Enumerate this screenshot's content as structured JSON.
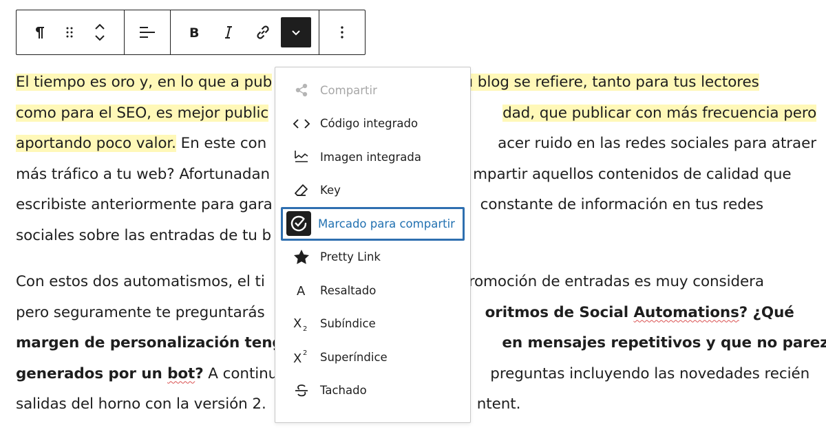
{
  "toolbar": {
    "buttons": [
      {
        "name": "paragraph-icon",
        "label": "Paragraph"
      },
      {
        "name": "drag-handle-icon",
        "label": "Drag"
      },
      {
        "name": "move-up-down-icon",
        "label": "Move"
      },
      {
        "name": "align-icon",
        "label": "Align"
      },
      {
        "name": "bold-icon",
        "label": "Bold"
      },
      {
        "name": "italic-icon",
        "label": "Italic"
      },
      {
        "name": "link-icon",
        "label": "Link"
      },
      {
        "name": "chevron-down-icon",
        "label": "More"
      },
      {
        "name": "options-icon",
        "label": "Options"
      }
    ],
    "active_color": "#1e1e1e"
  },
  "paragraph1": {
    "line1_hl_a": "El tiempo es oro y, en lo que a pub",
    "line1_hl_b": "tu blog se refiere, tanto para tus lectores",
    "line2_hl_a": "como para el SEO, es mejor public",
    "line2_hl_b": "dad, que publicar con más frecuencia pero",
    "line3_hl": "aportando poco valor.",
    "line3_a": " En este con",
    "line3_b": "acer ruido en las redes sociales para atraer",
    "line4_a": "más tráfico a tu web? Afortunadan",
    "line4_b": "mpartir aquellos contenidos de calidad que",
    "line5_a": "escribiste anteriormente para gara",
    "line5_b": "constante de información en tus redes",
    "line6_a": "sociales sobre las entradas de tu b",
    "highlight_color": "#fff8b8"
  },
  "paragraph2": {
    "line1_a": "Con estos dos automatismos, el ti",
    "line1_b": "romoción de entradas es muy considera",
    "line2_a": "pero seguramente te preguntarás",
    "line2_b1": "oritmos de Social ",
    "line2_b2": "Automations",
    "line2_b3": "? ¿Qué",
    "line3_a": "margen de personalización tengo",
    "line3_b": "en mensajes repetitivos y que no parezcan",
    "line4_a1": "generados por un ",
    "line4_a2": "bot",
    "line4_a3": "?",
    "line4_a4": " A continua",
    "line4_b": "preguntas incluyendo las novedades recién",
    "line5_a": "salidas del horno con la versión 2.",
    "line5_b": "ntent."
  },
  "menu": {
    "items": [
      {
        "label": "Compartir",
        "icon": "share-icon",
        "disabled": true
      },
      {
        "label": "Código integrado",
        "icon": "code-icon"
      },
      {
        "label": "Imagen integrada",
        "icon": "image-icon"
      },
      {
        "label": "Key",
        "icon": "eraser-icon"
      },
      {
        "label": "Marcado para compartir",
        "icon": "clock-check-icon",
        "focused": true
      },
      {
        "label": "Pretty Link",
        "icon": "star-icon"
      },
      {
        "label": "Resaltado",
        "icon": "highlight-icon"
      },
      {
        "label": "Subíndice",
        "icon": "subscript-icon"
      },
      {
        "label": "Superíndice",
        "icon": "superscript-icon"
      },
      {
        "label": "Tachado",
        "icon": "strikethrough-icon"
      }
    ],
    "focus_color": "#2271b1"
  }
}
